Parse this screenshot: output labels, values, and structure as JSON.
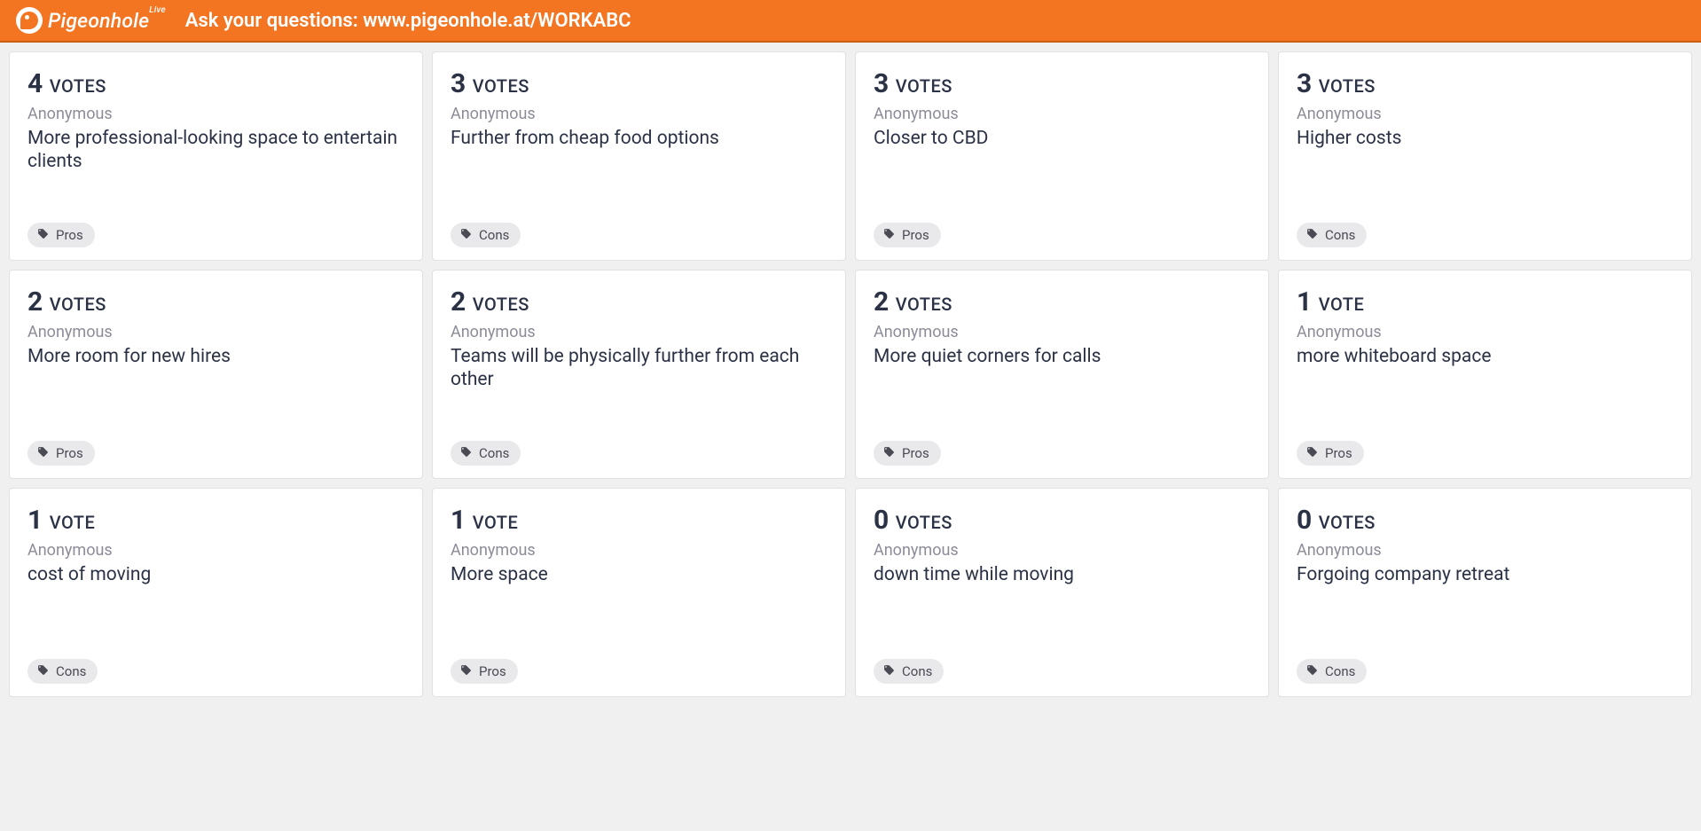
{
  "header": {
    "brand_name": "Pigeonhole",
    "brand_suffix": "Live",
    "prompt": "Ask your questions: www.pigeonhole.at/WORKABC"
  },
  "vote_label_singular": "VOTE",
  "vote_label_plural": "VOTES",
  "cards": [
    {
      "votes": 4,
      "author": "Anonymous",
      "text": "More professional-looking space to entertain clients",
      "tag": "Pros"
    },
    {
      "votes": 3,
      "author": "Anonymous",
      "text": "Further from cheap food options",
      "tag": "Cons"
    },
    {
      "votes": 3,
      "author": "Anonymous",
      "text": "Closer to CBD",
      "tag": "Pros"
    },
    {
      "votes": 3,
      "author": "Anonymous",
      "text": "Higher costs",
      "tag": "Cons"
    },
    {
      "votes": 2,
      "author": "Anonymous",
      "text": "More room for new hires",
      "tag": "Pros"
    },
    {
      "votes": 2,
      "author": "Anonymous",
      "text": "Teams will be physically further from each other",
      "tag": "Cons"
    },
    {
      "votes": 2,
      "author": "Anonymous",
      "text": "More quiet corners for calls",
      "tag": "Pros"
    },
    {
      "votes": 1,
      "author": "Anonymous",
      "text": "more whiteboard space",
      "tag": "Pros"
    },
    {
      "votes": 1,
      "author": "Anonymous",
      "text": "cost of moving",
      "tag": "Cons"
    },
    {
      "votes": 1,
      "author": "Anonymous",
      "text": "More space",
      "tag": "Pros"
    },
    {
      "votes": 0,
      "author": "Anonymous",
      "text": "down time while moving",
      "tag": "Cons"
    },
    {
      "votes": 0,
      "author": "Anonymous",
      "text": "Forgoing company retreat",
      "tag": "Cons"
    }
  ]
}
